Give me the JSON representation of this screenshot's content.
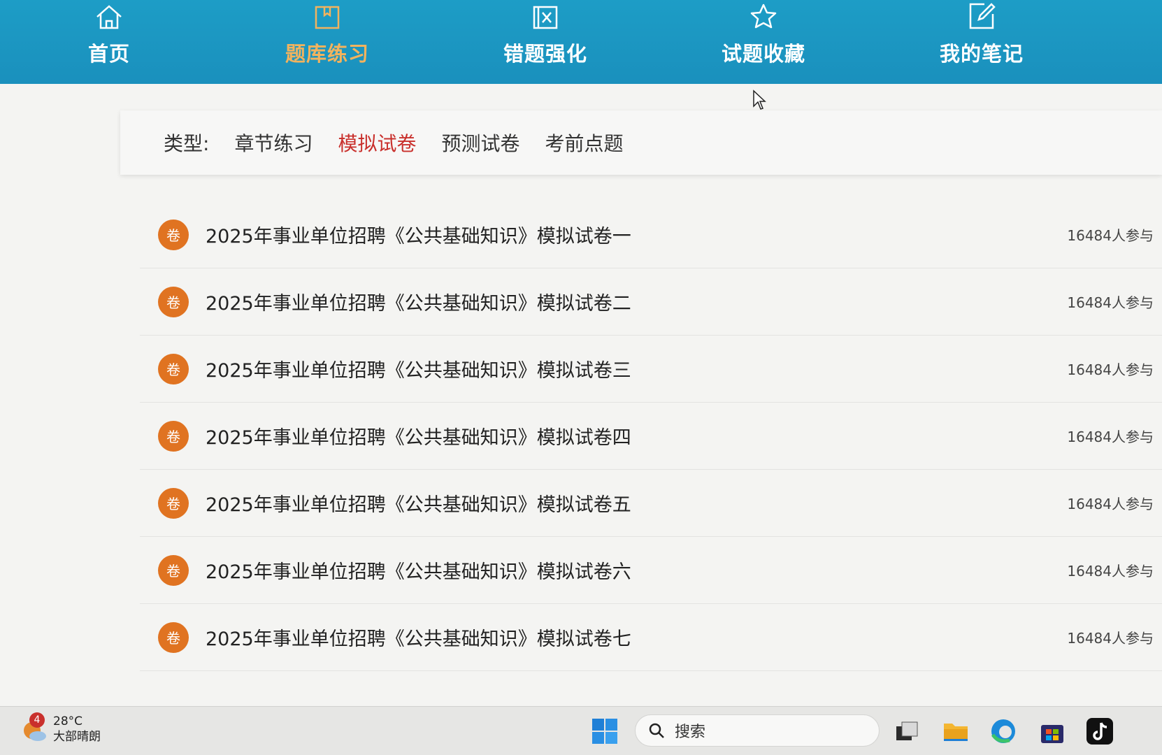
{
  "nav": {
    "items": [
      {
        "label": "首页",
        "icon": "home-icon"
      },
      {
        "label": "题库练习",
        "icon": "book-icon",
        "active": true
      },
      {
        "label": "错题强化",
        "icon": "wrong-question-icon"
      },
      {
        "label": "试题收藏",
        "icon": "star-icon"
      },
      {
        "label": "我的笔记",
        "icon": "note-edit-icon"
      }
    ]
  },
  "filter": {
    "label": "类型:",
    "options": [
      {
        "label": "章节练习"
      },
      {
        "label": "模拟试卷",
        "active": true
      },
      {
        "label": "预测试卷"
      },
      {
        "label": "考前点题"
      }
    ]
  },
  "papers": [
    {
      "badge": "卷",
      "title": "2025年事业单位招聘《公共基础知识》模拟试卷一",
      "count": "16484人参与"
    },
    {
      "badge": "卷",
      "title": "2025年事业单位招聘《公共基础知识》模拟试卷二",
      "count": "16484人参与"
    },
    {
      "badge": "卷",
      "title": "2025年事业单位招聘《公共基础知识》模拟试卷三",
      "count": "16484人参与"
    },
    {
      "badge": "卷",
      "title": "2025年事业单位招聘《公共基础知识》模拟试卷四",
      "count": "16484人参与"
    },
    {
      "badge": "卷",
      "title": "2025年事业单位招聘《公共基础知识》模拟试卷五",
      "count": "16484人参与"
    },
    {
      "badge": "卷",
      "title": "2025年事业单位招聘《公共基础知识》模拟试卷六",
      "count": "16484人参与"
    },
    {
      "badge": "卷",
      "title": "2025年事业单位招聘《公共基础知识》模拟试卷七",
      "count": "16484人参与"
    }
  ],
  "taskbar": {
    "weather": {
      "badge": "4",
      "temp": "28°C",
      "desc": "大部晴朗"
    },
    "search": {
      "placeholder": "搜索"
    }
  },
  "colors": {
    "nav_bg": "#1d9dc6",
    "nav_active": "#f2b35e",
    "filter_active": "#c9302c",
    "badge_bg": "#e07321"
  }
}
